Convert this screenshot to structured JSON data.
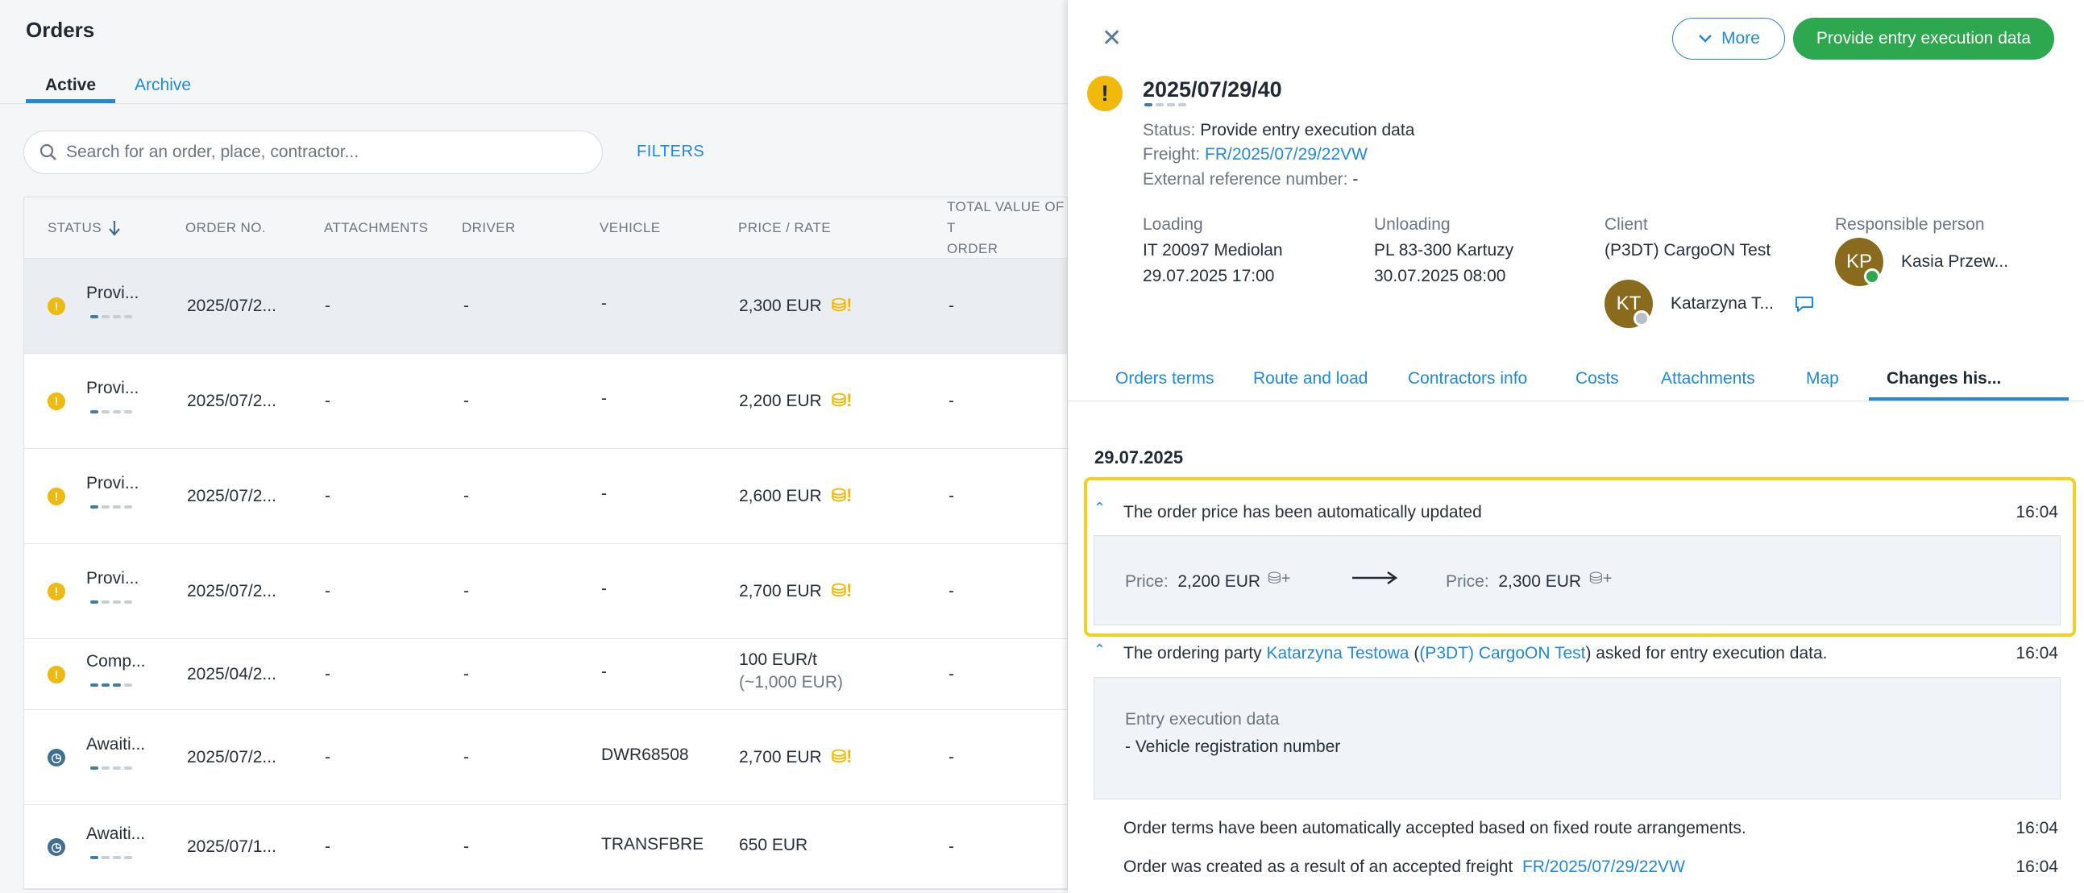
{
  "page": {
    "title": "Orders"
  },
  "tabs": [
    {
      "label": "Active"
    },
    {
      "label": "Archive"
    }
  ],
  "search": {
    "placeholder": "Search for an order, place, contractor..."
  },
  "filters_label": "FILTERS",
  "table": {
    "headers": [
      "STATUS",
      "ORDER NO.",
      "ATTACHMENTS",
      "DRIVER",
      "VEHICLE",
      "PRICE / RATE",
      "TOTAL VALUE OF T",
      "ORDER"
    ],
    "rows": [
      {
        "status": "Provi...",
        "order": "2025/07/2...",
        "attachments": "-",
        "driver": "-",
        "vehicle": "-",
        "price": "2,300 EUR",
        "price_sub": "",
        "total": "-",
        "icon": "warning",
        "progress": 1
      },
      {
        "status": "Provi...",
        "order": "2025/07/2...",
        "attachments": "-",
        "driver": "-",
        "vehicle": "-",
        "price": "2,200 EUR",
        "price_sub": "",
        "total": "-",
        "icon": "warning",
        "progress": 1
      },
      {
        "status": "Provi...",
        "order": "2025/07/2...",
        "attachments": "-",
        "driver": "-",
        "vehicle": "-",
        "price": "2,600 EUR",
        "price_sub": "",
        "total": "-",
        "icon": "warning",
        "progress": 1
      },
      {
        "status": "Provi...",
        "order": "2025/07/2...",
        "attachments": "-",
        "driver": "-",
        "vehicle": "-",
        "price": "2,700 EUR",
        "price_sub": "",
        "total": "-",
        "icon": "warning",
        "progress": 1
      },
      {
        "status": "Comp...",
        "order": "2025/04/2...",
        "attachments": "-",
        "driver": "-",
        "vehicle": "-",
        "price": "100 EUR/t",
        "price_sub": "(~1,000 EUR)",
        "total": "-",
        "icon": "warning",
        "progress": 3
      },
      {
        "status": "Awaiti...",
        "order": "2025/07/2...",
        "attachments": "-",
        "driver": "-",
        "vehicle": "DWR68508",
        "price": "2,700 EUR",
        "price_sub": "",
        "total": "-",
        "icon": "clock",
        "progress": 1
      },
      {
        "status": "Awaiti...",
        "order": "2025/07/1...",
        "attachments": "-",
        "driver": "-",
        "vehicle": "TRANSFBRE",
        "price": "650 EUR",
        "price_sub": "",
        "total": "-",
        "icon": "clock",
        "progress": 1
      }
    ]
  },
  "detail": {
    "more_label": "More",
    "primary_label": "Provide entry execution data",
    "order_number": "2025/07/29/40",
    "status_label": "Status:",
    "status_value": "Provide entry execution data",
    "freight_label": "Freight:",
    "freight_value": "FR/2025/07/29/22VW",
    "extref_label": "External reference number:",
    "extref_value": "-",
    "loading": {
      "label": "Loading",
      "place": "IT 20097 Mediolan",
      "date": "29.07.2025 17:00"
    },
    "unloading": {
      "label": "Unloading",
      "place": "PL 83-300 Kartuzy",
      "date": "30.07.2025 08:00"
    },
    "client": {
      "label": "Client",
      "name": "(P3DT) CargoON Test",
      "initials": "KT",
      "person": "Katarzyna T..."
    },
    "responsible": {
      "label": "Responsible person",
      "initials": "KP",
      "person": "Kasia Przew..."
    },
    "tabs": [
      "Orders terms",
      "Route and load",
      "Contractors info",
      "Costs",
      "Attachments",
      "Map",
      "Changes his..."
    ],
    "history_date": "29.07.2025",
    "events": {
      "price_update": {
        "text": "The order price has been automatically updated",
        "time": "16:04",
        "price_label": "Price:",
        "old_price": "2,200 EUR",
        "new_price": "2,300 EUR"
      },
      "ask": {
        "text_a": "The ordering party ",
        "person": "Katarzyna Testowa",
        "text_b": " (",
        "company": "(P3DT) CargoON Test",
        "text_c": ") asked for entry execution data.",
        "time": "16:04",
        "box_title": "Entry execution data",
        "box_item": "- Vehicle registration number"
      },
      "terms": {
        "text": "Order terms have been automatically accepted based on fixed route arrangements.",
        "time": "16:04"
      },
      "created": {
        "text": "Order was created as a result of an accepted freight",
        "link": "FR/2025/07/29/22VW",
        "time": "16:04"
      }
    }
  },
  "colors": {
    "accent": "#1f8adc",
    "primary_button": "#2ea84f",
    "warning": "#f0b90b",
    "highlight_border": "#f2d020"
  }
}
